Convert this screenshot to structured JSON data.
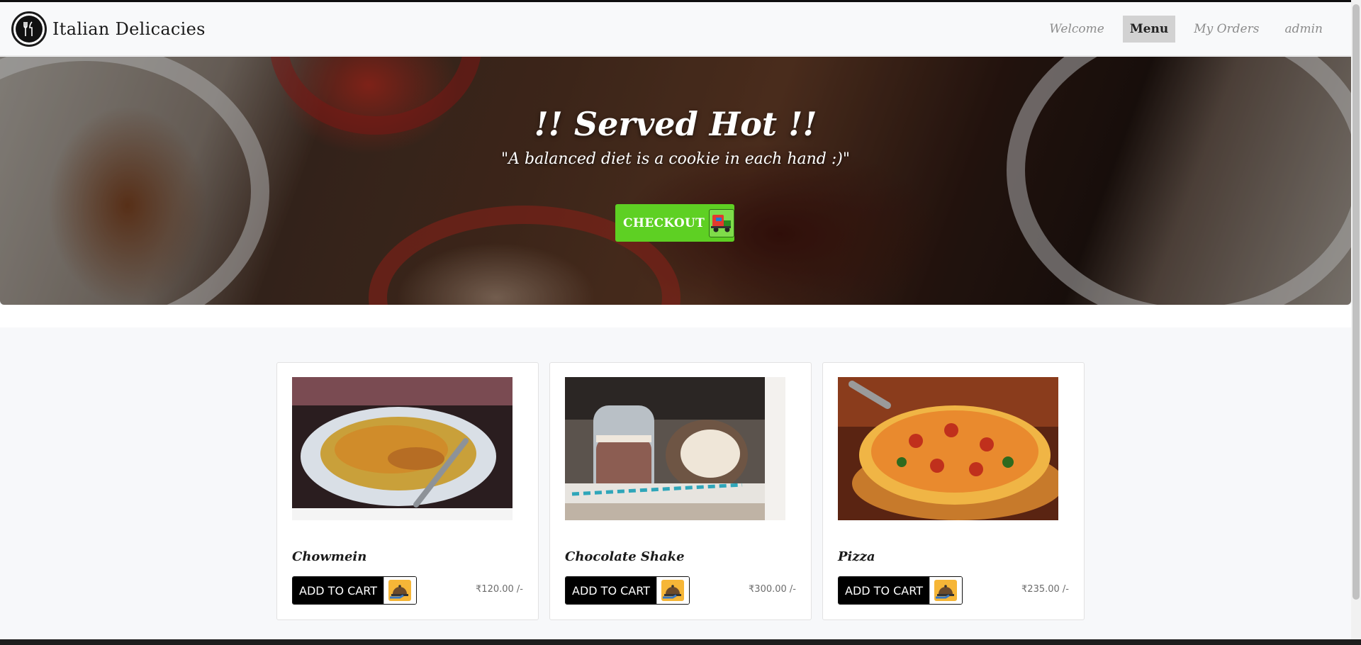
{
  "navbar": {
    "brand": "Italian Delicacies",
    "links": [
      {
        "label": "Welcome",
        "active": false
      },
      {
        "label": "Menu",
        "active": true
      },
      {
        "label": "My Orders",
        "active": false
      },
      {
        "label": "admin",
        "active": false
      }
    ]
  },
  "hero": {
    "title": "!! Served Hot !!",
    "quote": "\"A balanced diet is a cookie in each hand :)\"",
    "checkout_label": "CHECKOUT",
    "checkout_icon": "delivery-cart-icon"
  },
  "menu": {
    "items": [
      {
        "name": "Chowmein",
        "add_label": "ADD TO CART",
        "price": "₹120.00 /-",
        "image": "chowmein-photo"
      },
      {
        "name": "Chocolate Shake",
        "add_label": "ADD TO CART",
        "price": "₹300.00 /-",
        "image": "chocolate-shake-photo"
      },
      {
        "name": "Pizza",
        "add_label": "ADD TO CART",
        "price": "₹235.00 /-",
        "image": "pizza-photo"
      }
    ]
  },
  "colors": {
    "accent_green": "#5ed023",
    "active_nav_bg": "#d2d2d2",
    "button_black": "#000000"
  }
}
